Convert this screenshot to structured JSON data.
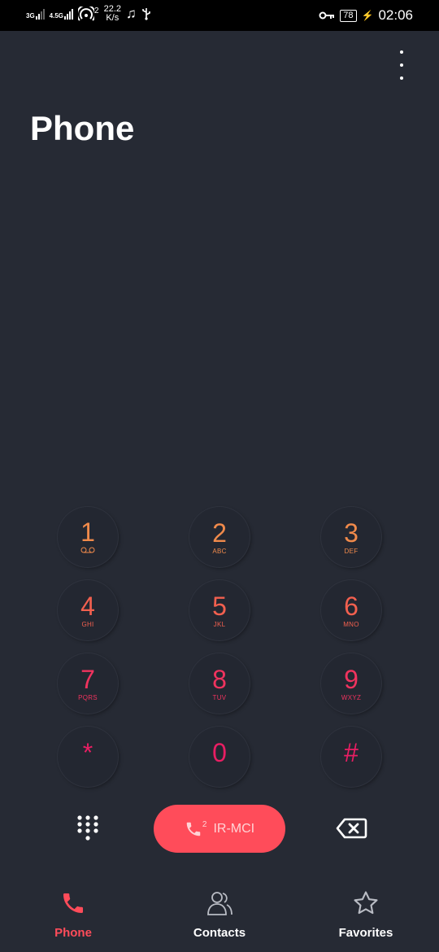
{
  "status_bar": {
    "network_1": "3G",
    "network_2": "4.5G",
    "hotspot_count": "2",
    "speed_value": "22.2",
    "speed_unit": "K/s",
    "battery": "78",
    "time": "02:06"
  },
  "header": {
    "title": "Phone"
  },
  "dialpad": {
    "keys": [
      {
        "digit": "1",
        "letters": "",
        "color": "#f08a4b"
      },
      {
        "digit": "2",
        "letters": "ABC",
        "color": "#f08a4b"
      },
      {
        "digit": "3",
        "letters": "DEF",
        "color": "#f08a4b"
      },
      {
        "digit": "4",
        "letters": "GHI",
        "color": "#f2604f"
      },
      {
        "digit": "5",
        "letters": "JKL",
        "color": "#f2604f"
      },
      {
        "digit": "6",
        "letters": "MNO",
        "color": "#f2604f"
      },
      {
        "digit": "7",
        "letters": "PQRS",
        "color": "#f0335e"
      },
      {
        "digit": "8",
        "letters": "TUV",
        "color": "#f0335e"
      },
      {
        "digit": "9",
        "letters": "WXYZ",
        "color": "#f0335e"
      },
      {
        "digit": "*",
        "letters": "",
        "color": "#e91e63"
      },
      {
        "digit": "0",
        "letters": "",
        "color": "#e91e63"
      },
      {
        "digit": "#",
        "letters": "",
        "color": "#e91e63"
      }
    ],
    "voicemail_icon": "voicemail-icon"
  },
  "call_button": {
    "sim": "2",
    "label": "IR-MCI",
    "color": "#ff4c5a"
  },
  "bottom_nav": {
    "phone": "Phone",
    "contacts": "Contacts",
    "favorites": "Favorites",
    "active_color": "#ff4c5a"
  }
}
